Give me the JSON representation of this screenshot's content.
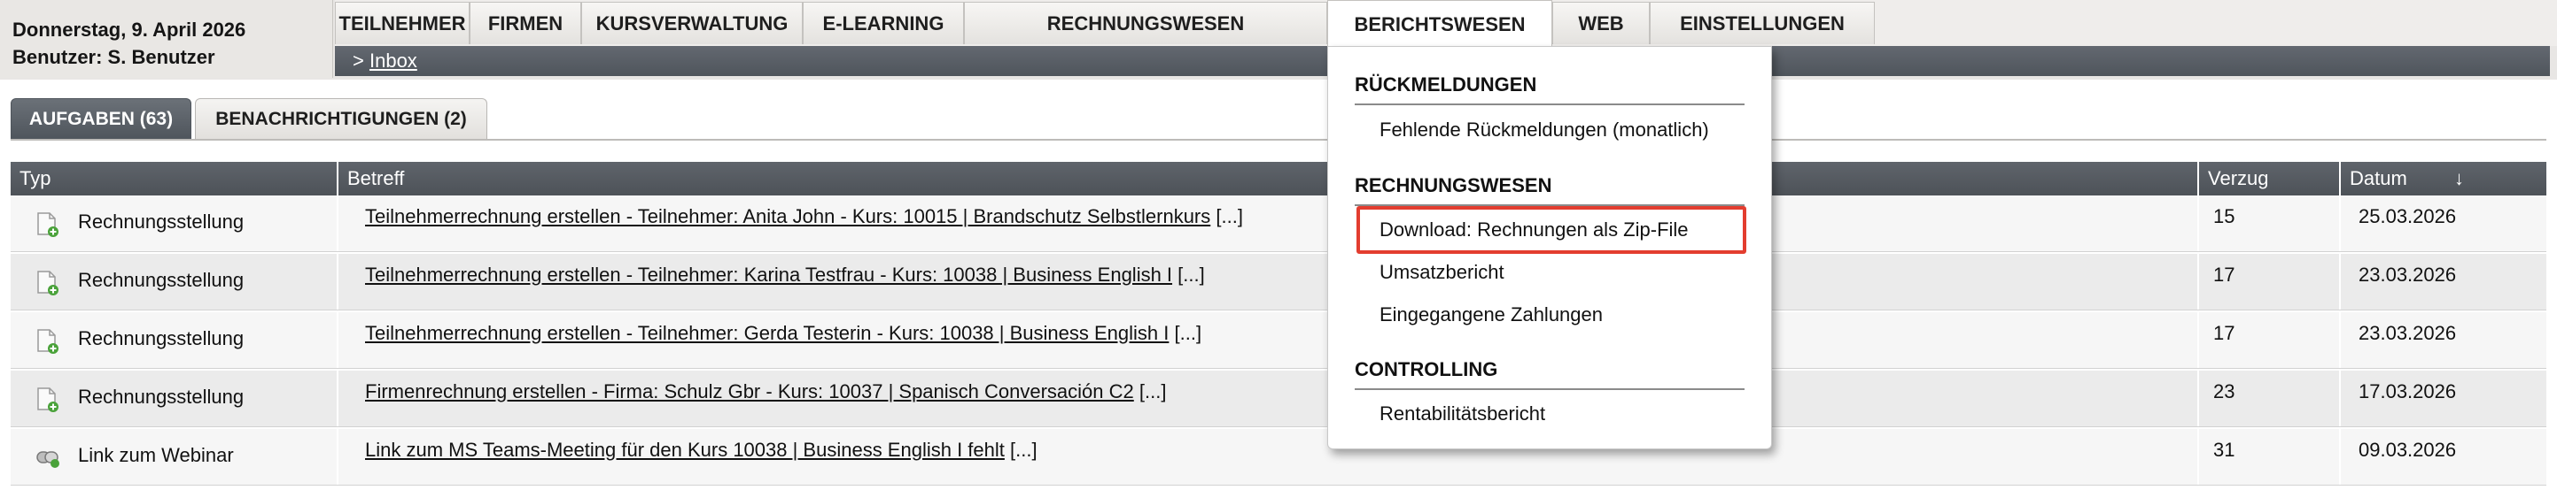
{
  "header": {
    "date": "Donnerstag, 9. April 2026",
    "user": "Benutzer: S. Benutzer"
  },
  "nav": {
    "tabs": [
      {
        "label": "TEILNEHMER"
      },
      {
        "label": "FIRMEN"
      },
      {
        "label": "KURSVERWALTUNG"
      },
      {
        "label": "E-LEARNING"
      },
      {
        "label": "RECHNUNGSWESEN"
      },
      {
        "label": "BERICHTSWESEN",
        "active": true
      },
      {
        "label": "WEB"
      },
      {
        "label": "EINSTELLUNGEN"
      }
    ]
  },
  "breadcrumb": {
    "prefix": ">",
    "link": "Inbox"
  },
  "content_tabs": [
    {
      "label": "AUFGABEN (63)",
      "active": true
    },
    {
      "label": "BENACHRICHTIGUNGEN (2)",
      "active": false
    }
  ],
  "table": {
    "columns": {
      "typ": "Typ",
      "betreff": "Betreff",
      "verzug": "Verzug",
      "datum": "Datum",
      "sort_indicator": "↓"
    },
    "rows": [
      {
        "typ": "Rechnungsstellung",
        "icon": "document-add-icon",
        "betreff": "Teilnehmerrechnung erstellen - Teilnehmer: Anita John - Kurs: 10015 | Brandschutz Selbstlernkurs",
        "more": "[...]",
        "verzug": "15",
        "datum": "25.03.2026"
      },
      {
        "typ": "Rechnungsstellung",
        "icon": "document-add-icon",
        "betreff": "Teilnehmerrechnung erstellen - Teilnehmer: Karina Testfrau - Kurs: 10038 | Business English I",
        "more": "[...]",
        "verzug": "17",
        "datum": "23.03.2026"
      },
      {
        "typ": "Rechnungsstellung",
        "icon": "document-add-icon",
        "betreff": "Teilnehmerrechnung erstellen - Teilnehmer: Gerda Testerin - Kurs: 10038 | Business English I",
        "more": "[...]",
        "verzug": "17",
        "datum": "23.03.2026"
      },
      {
        "typ": "Rechnungsstellung",
        "icon": "document-add-icon",
        "betreff": "Firmenrechnung erstellen - Firma: Schulz Gbr - Kurs: 10037 | Spanisch Conversación C2",
        "more": "[...]",
        "verzug": "23",
        "datum": "17.03.2026"
      },
      {
        "typ": "Link zum Webinar",
        "icon": "webinar-icon",
        "betreff": "Link zum MS Teams-Meeting für den Kurs 10038 | Business English I fehlt",
        "more": "[...]",
        "verzug": "31",
        "datum": "09.03.2026"
      }
    ]
  },
  "dropdown": {
    "sections": [
      {
        "heading": "RÜCKMELDUNGEN",
        "items": [
          "Fehlende Rückmeldungen (monatlich)"
        ]
      },
      {
        "heading": "RECHNUNGSWESEN",
        "items": [
          "Download: Rechnungen als Zip-File",
          "Umsatzbericht",
          "Eingegangene Zahlungen"
        ]
      },
      {
        "heading": "CONTROLLING",
        "items": [
          "Rentabilitätsbericht"
        ]
      }
    ],
    "highlighted_item": "Download: Rechnungen als Zip-File",
    "highlight_color": "#e33d2f"
  }
}
